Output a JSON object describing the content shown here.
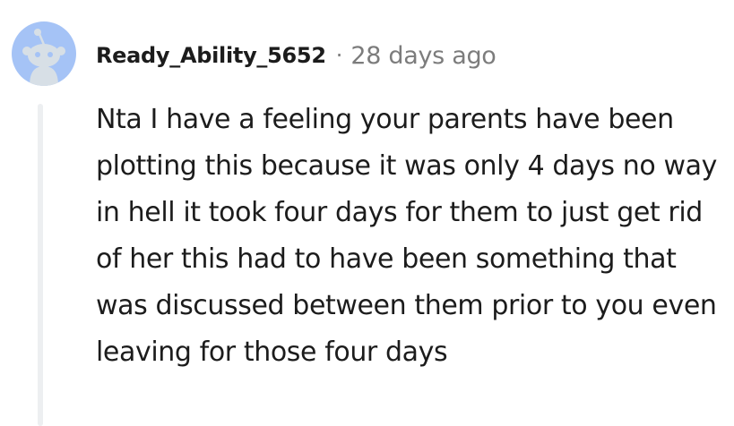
{
  "comment": {
    "author": "Ready_Ability_5652",
    "separator": "·",
    "timestamp": "28 days ago",
    "avatar_icon": "reddit-snoo-avatar-icon",
    "body": "Nta I have a feeling your parents have been plotting this because it was only 4 days no way in hell it took four days for them to just get rid of her this had to have been something that was discussed between them prior to you even leaving for those four days"
  },
  "colors": {
    "avatar_bg": "#a5c3f6",
    "avatar_figure": "#d7dfe6",
    "text_primary": "#1c1c1c",
    "text_meta": "#7c7c7c",
    "thread_line": "#edeff1"
  }
}
